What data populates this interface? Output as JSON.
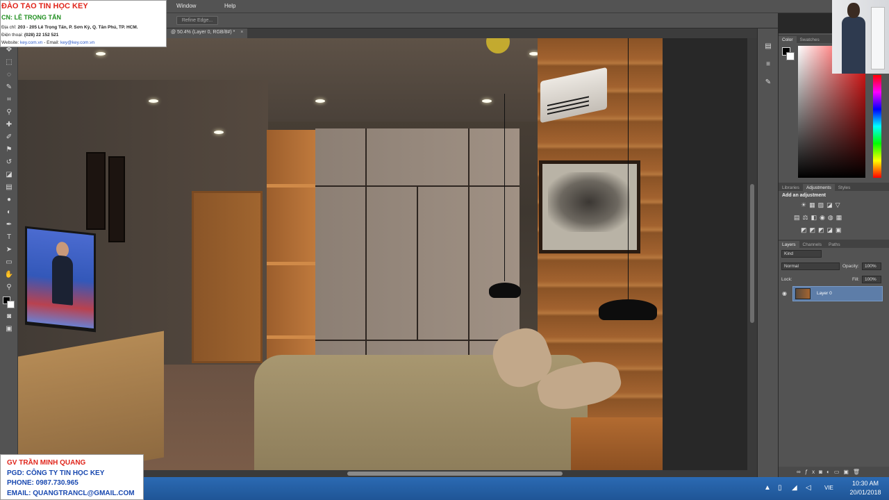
{
  "menu": {
    "items": [
      "Window",
      "Help"
    ]
  },
  "options_bar": {
    "refine_edge_label": "Refine Edge..."
  },
  "document": {
    "tab_title": "@ 50.4% (Layer 0, RGB/8#) *",
    "close": "×"
  },
  "panels": {
    "color_tabs": [
      "Color",
      "Swatches"
    ],
    "adjust_tabs": [
      "Libraries",
      "Adjustments",
      "Styles"
    ],
    "add_adjustment": "Add an adjustment",
    "layers_tabs": [
      "Layers",
      "Channels",
      "Paths"
    ],
    "filter_kind": "Kind",
    "blend_mode": "Normal",
    "opacity_label": "Opacity:",
    "opacity_value": "100%",
    "lock_label": "Lock:",
    "fill_label": "Fill:",
    "fill_value": "100%",
    "layer_name": "Layer 0"
  },
  "taskbar": {
    "language": "VIE",
    "time": "10:30 AM",
    "date": "20/01/2018"
  },
  "info_box": {
    "title": "ĐÀO TẠO TIN HỌC KEY",
    "subtitle": "CN: LÊ TRỌNG TẤN",
    "address_label": "Địa chỉ:",
    "address": "203 - 205 Lê Trọng Tấn, P. Sơn Kỳ, Q. Tân Phú, TP. HCM.",
    "phone_label": "Điện thoại:",
    "phone": "(028) 22 152 521",
    "website_label": "Website:",
    "website": "key.com.vn",
    "email_label": "- Email:",
    "email": "key@key.com.vn"
  },
  "teacher": {
    "name": "GV TRẦN MINH QUANG",
    "org": "PGD: CÔNG TY TIN HỌC KEY",
    "phone": "PHONE: 0987.730.965",
    "email": "EMAIL: QUANGTRANCL@GMAIL.COM"
  },
  "icons": {
    "tools": [
      "move",
      "marquee",
      "lasso",
      "quick-select",
      "crop",
      "eyedropper",
      "healing",
      "brush",
      "stamp",
      "history-brush",
      "eraser",
      "gradient",
      "blur",
      "dodge",
      "pen",
      "type",
      "path-select",
      "shape",
      "hand",
      "zoom"
    ],
    "accent": "#5d7da8",
    "taskbar": "#2b6ab3"
  }
}
